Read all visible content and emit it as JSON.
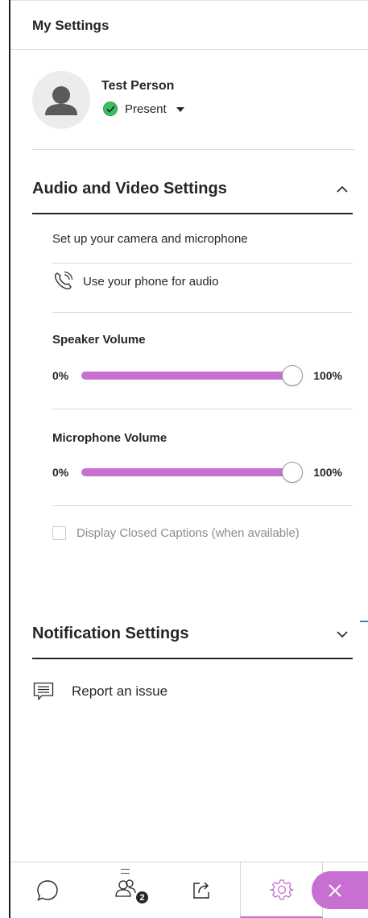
{
  "header": {
    "title": "My Settings"
  },
  "profile": {
    "name": "Test Person",
    "status": "Present"
  },
  "audio_video": {
    "title": "Audio and Video Settings",
    "expanded": true,
    "setup_text": "Set up your camera and microphone",
    "phone_text": "Use your phone for audio",
    "speaker": {
      "label": "Speaker Volume",
      "min_label": "0%",
      "max_label": "100%",
      "value_percent": 100
    },
    "microphone": {
      "label": "Microphone Volume",
      "min_label": "0%",
      "max_label": "100%",
      "value_percent": 100
    },
    "closed_captions": {
      "label": "Display Closed Captions (when available)",
      "checked": false,
      "disabled": true
    }
  },
  "notification": {
    "title": "Notification Settings",
    "expanded": false
  },
  "report": {
    "label": "Report an issue"
  },
  "bottom_bar": {
    "tabs": [
      {
        "icon": "chat-bubble-icon"
      },
      {
        "icon": "participants-icon",
        "badge": "2"
      },
      {
        "icon": "share-content-icon"
      },
      {
        "icon": "gear-icon",
        "active": true
      }
    ],
    "close_icon": "close-icon"
  },
  "colors": {
    "accent": "#c86fd2",
    "present_green": "#3cbf62",
    "text": "#262626",
    "muted": "#8c8c8c"
  }
}
